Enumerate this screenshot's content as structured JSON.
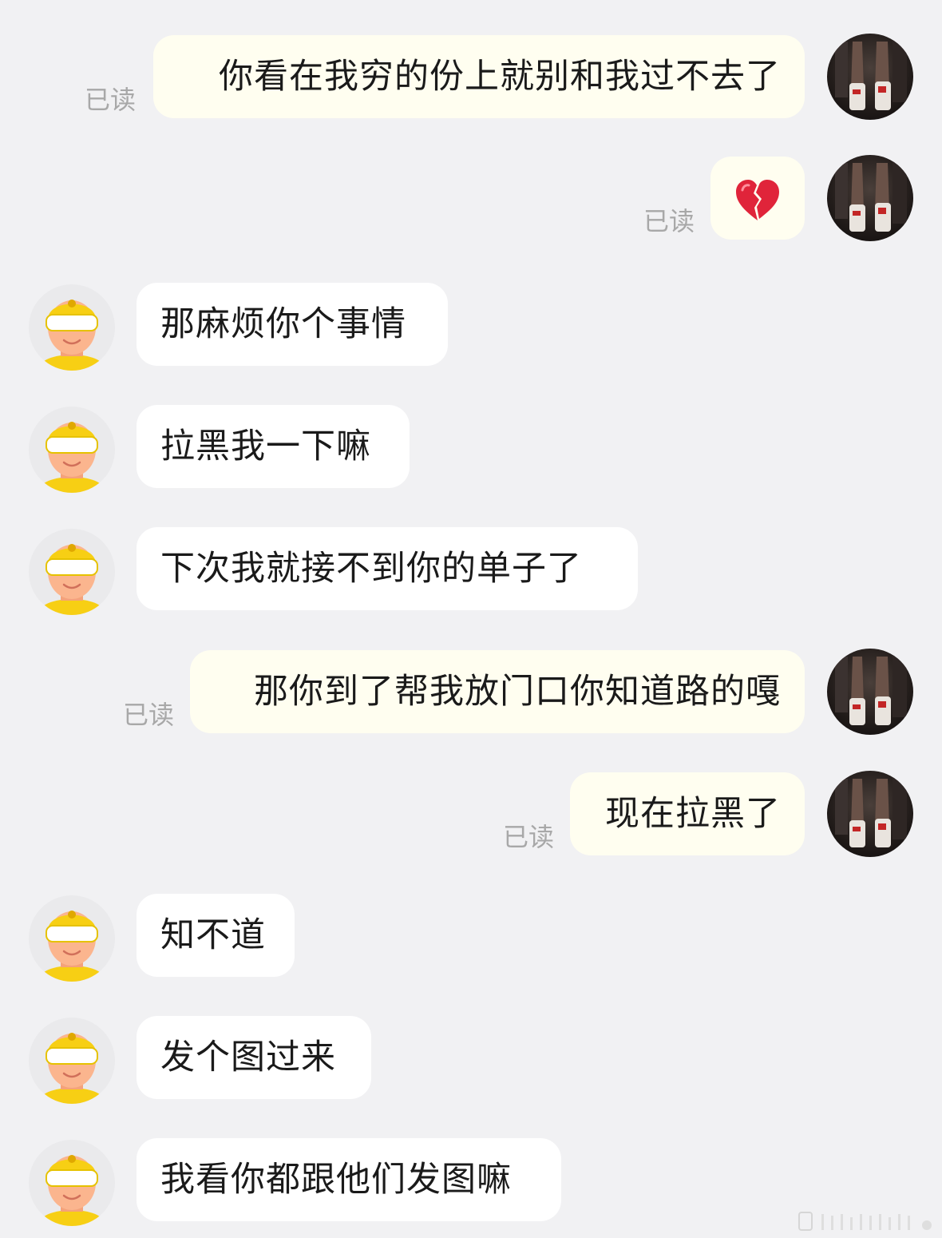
{
  "chat": {
    "read_label": "已读",
    "messages": [
      {
        "dir": "out",
        "text": "你看在我穷的份上就别和我过不去了",
        "read": "已读"
      },
      {
        "dir": "out",
        "text": "",
        "emoji": "broken-heart",
        "read": "已读"
      },
      {
        "dir": "in",
        "text": "那麻烦你个事情"
      },
      {
        "dir": "in",
        "text": "拉黑我一下嘛"
      },
      {
        "dir": "in",
        "text": "下次我就接不到你的单子了"
      },
      {
        "dir": "out",
        "text": "那你到了帮我放门口你知道路的嘎",
        "read": "已读"
      },
      {
        "dir": "out",
        "text": "现在拉黑了",
        "read": "已读"
      },
      {
        "dir": "in",
        "text": "知不道"
      },
      {
        "dir": "in",
        "text": "发个图过来"
      },
      {
        "dir": "in",
        "text": "我看你都跟他们发图嘛"
      }
    ]
  },
  "colors": {
    "background": "#f1f1f3",
    "outgoing_bubble": "#fffef0",
    "incoming_bubble": "#ffffff",
    "read_text": "#a8a8a8",
    "rider_yellow": "#f7cf14"
  },
  "icons": {
    "user_avatar": "user-avatar-photo",
    "rider_avatar": "delivery-rider-avatar",
    "emoji": "broken-heart-icon"
  }
}
